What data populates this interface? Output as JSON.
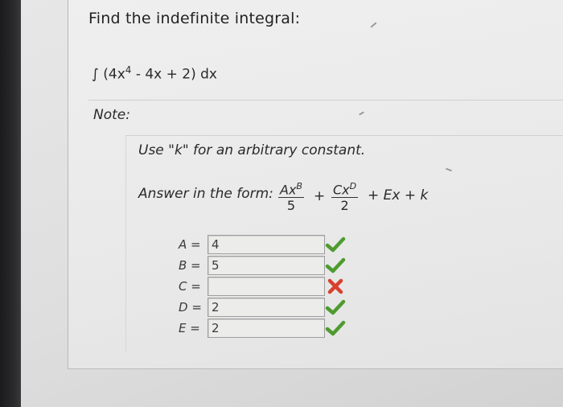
{
  "question": {
    "title": "Find the indefinite integral:",
    "integral_expression": {
      "prefix": "∫ (4x",
      "exponent": "4",
      "suffix": " - 4x + 2) dx"
    }
  },
  "note": {
    "label": "Note:",
    "hint": "Use \"k\" for an arbitrary constant.",
    "form_prefix": "Answer in the form:",
    "term1": {
      "num_base": "Ax",
      "num_exp": "B",
      "den": "5"
    },
    "plus": "+",
    "term2": {
      "num_base": "Cx",
      "num_exp": "D",
      "den": "2"
    },
    "tail": "+ Ex + k"
  },
  "answers": [
    {
      "label": "A =",
      "value": "4",
      "status": "correct"
    },
    {
      "label": "B =",
      "value": "5",
      "status": "correct"
    },
    {
      "label": "C =",
      "value": "",
      "status": "incorrect"
    },
    {
      "label": "D =",
      "value": "2",
      "status": "correct"
    },
    {
      "label": "E =",
      "value": "2",
      "status": "correct"
    }
  ],
  "colors": {
    "correct": "#4e9b2e",
    "incorrect": "#d6412e"
  }
}
